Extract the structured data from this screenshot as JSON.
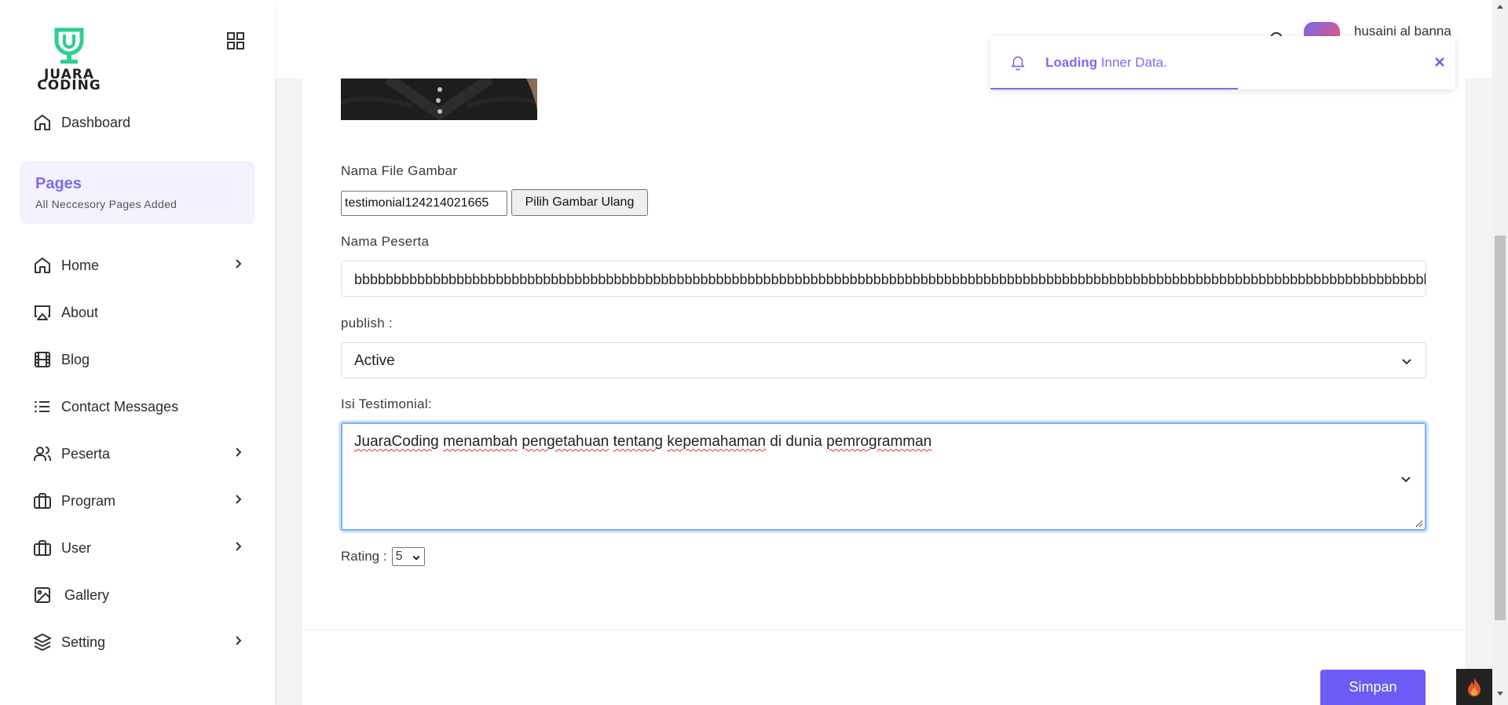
{
  "brand": {
    "logo_line1": "JUARA",
    "logo_line2": "CODING",
    "accent": "#7a6cf0",
    "button": "#6a5cf5"
  },
  "sidebar": {
    "top_item": {
      "label": "Dashboard",
      "icon": "home-icon"
    },
    "section": {
      "title": "Pages",
      "subtitle": "All Neccesory Pages Added"
    },
    "items": [
      {
        "label": "Home",
        "icon": "home-icon",
        "has_submenu": true
      },
      {
        "label": "About",
        "icon": "airplay-icon",
        "has_submenu": false
      },
      {
        "label": "Blog",
        "icon": "film-icon",
        "has_submenu": false
      },
      {
        "label": "Contact Messages",
        "icon": "list-icon",
        "has_submenu": false
      },
      {
        "label": "Peserta",
        "icon": "users-icon",
        "has_submenu": true
      },
      {
        "label": "Program",
        "icon": "briefcase-icon",
        "has_submenu": true
      },
      {
        "label": "User",
        "icon": "briefcase-icon",
        "has_submenu": true
      },
      {
        "label": "Gallery",
        "icon": "image-icon",
        "has_submenu": false
      },
      {
        "label": "Setting",
        "icon": "layers-icon",
        "has_submenu": true
      }
    ]
  },
  "header": {
    "user_name": "husaini al banna"
  },
  "toast": {
    "bold": "Loading",
    "text": " Inner Data."
  },
  "form": {
    "file_label": "Nama File Gambar",
    "file_value": "testimonial124214021665",
    "file_button": "Pilih Gambar Ulang",
    "name_label": "Nama Peserta",
    "name_value": "bbbbbbbbbbbbbbbbbbbbbbbbbbbbbbbbbbbbbbbbbbbbbbbbbbbbbbbbbbbbbbbbbbbbbbbbbbbbbbbbbbbbbbbbbbbbbbbbbbbbbbbbbbbbbbbbbbbbbbbbbbbbbbbbbbbbbbbbbbb",
    "publish_label": "publish :",
    "publish_value": "Active",
    "testimonial_label": "Isi Testimonial:",
    "testimonial_words": [
      {
        "text": "JuaraCoding",
        "misspelled": true
      },
      {
        "text": "menambah",
        "misspelled": true
      },
      {
        "text": "pengetahuan",
        "misspelled": true
      },
      {
        "text": "tentang",
        "misspelled": true
      },
      {
        "text": "kepemahaman",
        "misspelled": true
      },
      {
        "text": "di",
        "misspelled": false
      },
      {
        "text": "dunia",
        "misspelled": false
      },
      {
        "text": "pemrogramman",
        "misspelled": true
      }
    ],
    "rating_label": "Rating :",
    "rating_value": "5",
    "save_button": "Simpan"
  }
}
